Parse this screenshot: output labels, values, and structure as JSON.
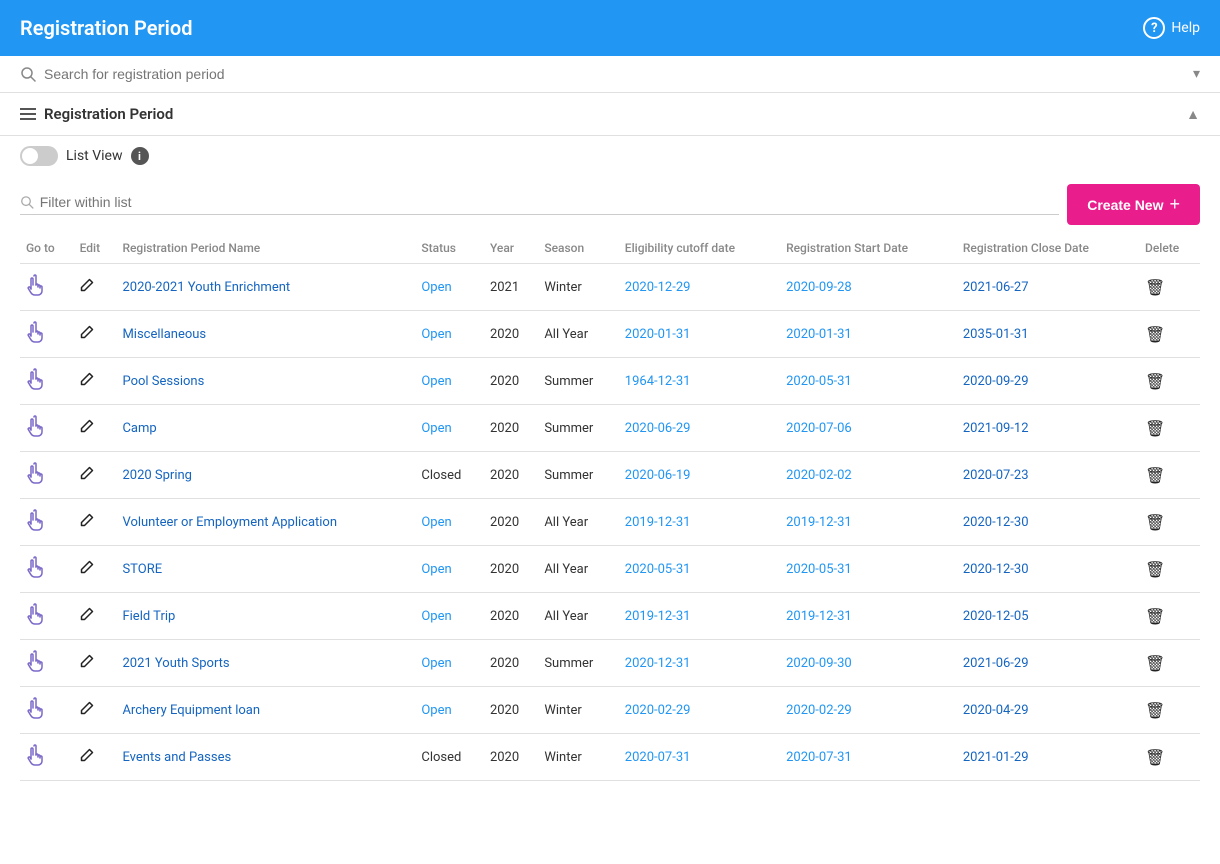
{
  "header": {
    "title": "Registration Period",
    "help_label": "Help"
  },
  "search": {
    "placeholder": "Search for registration period"
  },
  "section": {
    "title": "Registration Period",
    "chevron": "▲"
  },
  "list_view": {
    "label": "List View"
  },
  "filter": {
    "placeholder": "Filter within list"
  },
  "create_new": {
    "label": "Create New"
  },
  "table": {
    "columns": [
      "Go to",
      "Edit",
      "Registration Period Name",
      "Status",
      "Year",
      "Season",
      "Eligibility cutoff date",
      "Registration Start Date",
      "Registration Close Date",
      "Delete"
    ],
    "rows": [
      {
        "name": "2020-2021 Youth Enrichment",
        "status": "Open",
        "year": "2021",
        "season": "Winter",
        "eligibility": "2020-12-29",
        "start": "2020-09-28",
        "close": "2021-06-27"
      },
      {
        "name": "Miscellaneous",
        "status": "Open",
        "year": "2020",
        "season": "All Year",
        "eligibility": "2020-01-31",
        "start": "2020-01-31",
        "close": "2035-01-31"
      },
      {
        "name": "Pool Sessions",
        "status": "Open",
        "year": "2020",
        "season": "Summer",
        "eligibility": "1964-12-31",
        "start": "2020-05-31",
        "close": "2020-09-29"
      },
      {
        "name": "Camp",
        "status": "Open",
        "year": "2020",
        "season": "Summer",
        "eligibility": "2020-06-29",
        "start": "2020-07-06",
        "close": "2021-09-12"
      },
      {
        "name": "2020 Spring",
        "status": "Closed",
        "year": "2020",
        "season": "Summer",
        "eligibility": "2020-06-19",
        "start": "2020-02-02",
        "close": "2020-07-23"
      },
      {
        "name": "Volunteer or Employment Application",
        "status": "Open",
        "year": "2020",
        "season": "All Year",
        "eligibility": "2019-12-31",
        "start": "2019-12-31",
        "close": "2020-12-30"
      },
      {
        "name": "STORE",
        "status": "Open",
        "year": "2020",
        "season": "All Year",
        "eligibility": "2020-05-31",
        "start": "2020-05-31",
        "close": "2020-12-30"
      },
      {
        "name": "Field Trip",
        "status": "Open",
        "year": "2020",
        "season": "All Year",
        "eligibility": "2019-12-31",
        "start": "2019-12-31",
        "close": "2020-12-05"
      },
      {
        "name": "2021 Youth Sports",
        "status": "Open",
        "year": "2020",
        "season": "Summer",
        "eligibility": "2020-12-31",
        "start": "2020-09-30",
        "close": "2021-06-29"
      },
      {
        "name": "Archery Equipment loan",
        "status": "Open",
        "year": "2020",
        "season": "Winter",
        "eligibility": "2020-02-29",
        "start": "2020-02-29",
        "close": "2020-04-29"
      },
      {
        "name": "Events and Passes",
        "status": "Closed",
        "year": "2020",
        "season": "Winter",
        "eligibility": "2020-07-31",
        "start": "2020-07-31",
        "close": "2021-01-29"
      }
    ]
  }
}
